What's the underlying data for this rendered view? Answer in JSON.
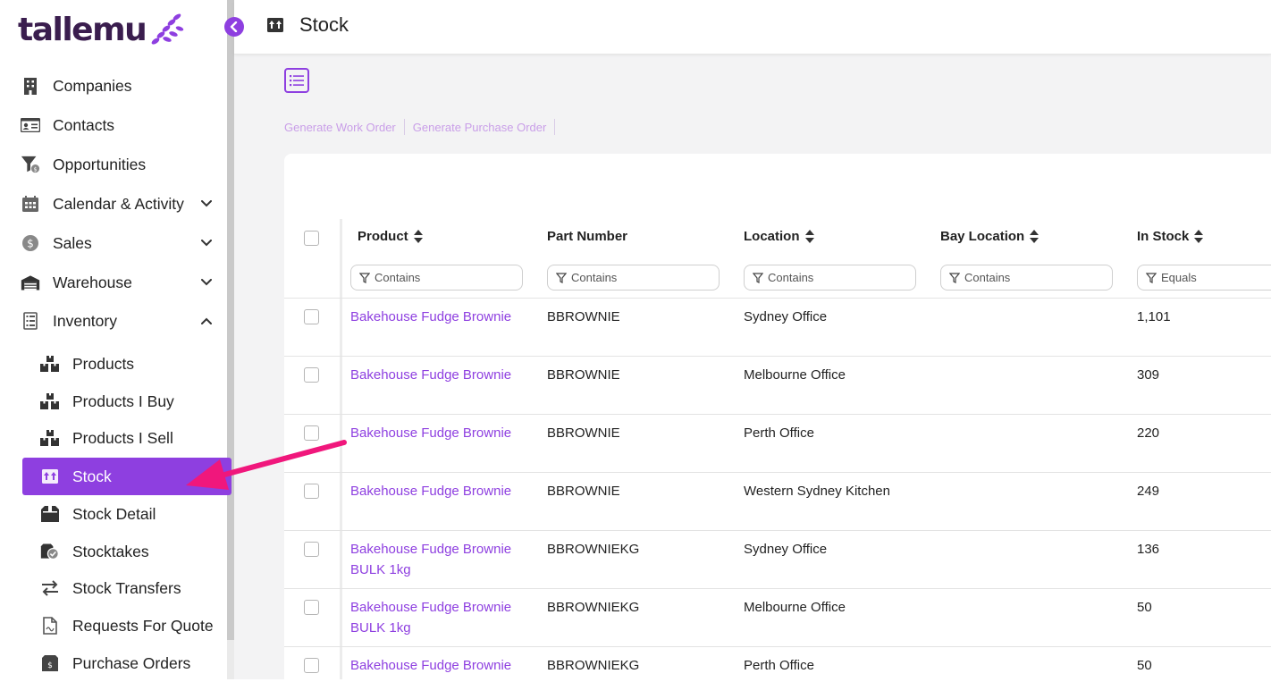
{
  "app": {
    "logo_text": "tallemu",
    "colors": {
      "accent": "#8e3fe0",
      "link": "#8e3fe0",
      "annotation_arrow": "#f0177c",
      "logo": "#3a1d4e"
    }
  },
  "sidebar": {
    "items": [
      {
        "label": "Companies",
        "icon": "building-icon"
      },
      {
        "label": "Contacts",
        "icon": "contact-card-icon"
      },
      {
        "label": "Opportunities",
        "icon": "funnel-dollar-icon"
      },
      {
        "label": "Calendar & Activity",
        "icon": "calendar-icon",
        "expandable": true
      },
      {
        "label": "Sales",
        "icon": "dollar-coin-icon",
        "expandable": true
      },
      {
        "label": "Warehouse",
        "icon": "warehouse-icon",
        "expandable": true
      },
      {
        "label": "Inventory",
        "icon": "inventory-list-icon",
        "expanded": true
      }
    ],
    "inventory_sub_items": [
      {
        "label": "Products",
        "icon": "boxes-icon"
      },
      {
        "label": "Products I Buy",
        "icon": "boxes-icon"
      },
      {
        "label": "Products I Sell",
        "icon": "boxes-icon"
      },
      {
        "label": "Stock",
        "icon": "stock-box-icon",
        "active": true
      },
      {
        "label": "Stock Detail",
        "icon": "open-box-icon"
      },
      {
        "label": "Stocktakes",
        "icon": "stocktake-check-icon"
      },
      {
        "label": "Stock Transfers",
        "icon": "transfer-arrows-icon"
      },
      {
        "label": "Requests For Quote",
        "icon": "document-icon"
      },
      {
        "label": "Purchase Orders",
        "icon": "purchase-order-icon"
      }
    ]
  },
  "header": {
    "title": "Stock"
  },
  "toolbar": {
    "actions": [
      "Generate Work Order",
      "Generate Purchase Order"
    ]
  },
  "grid": {
    "columns": [
      {
        "label": "Product",
        "sortable": true,
        "filter_placeholder": "Contains"
      },
      {
        "label": "Part Number",
        "sortable": false,
        "filter_placeholder": "Contains"
      },
      {
        "label": "Location",
        "sortable": true,
        "filter_placeholder": "Contains"
      },
      {
        "label": "Bay Location",
        "sortable": true,
        "filter_placeholder": "Contains"
      },
      {
        "label": "In Stock",
        "sortable": true,
        "filter_placeholder": "Equals"
      }
    ],
    "rows": [
      {
        "product": "Bakehouse Fudge Brownie",
        "part_number": "BBROWNIE",
        "location": "Sydney Office",
        "bay_location": "",
        "in_stock": "1,101"
      },
      {
        "product": "Bakehouse Fudge Brownie",
        "part_number": "BBROWNIE",
        "location": "Melbourne Office",
        "bay_location": "",
        "in_stock": "309"
      },
      {
        "product": "Bakehouse Fudge Brownie",
        "part_number": "BBROWNIE",
        "location": "Perth Office",
        "bay_location": "",
        "in_stock": "220"
      },
      {
        "product": "Bakehouse Fudge Brownie",
        "part_number": "BBROWNIE",
        "location": "Western Sydney Kitchen",
        "bay_location": "",
        "in_stock": "249"
      },
      {
        "product": "Bakehouse Fudge Brownie BULK 1kg",
        "part_number": "BBROWNIEKG",
        "location": "Sydney Office",
        "bay_location": "",
        "in_stock": "136"
      },
      {
        "product": "Bakehouse Fudge Brownie BULK 1kg",
        "part_number": "BBROWNIEKG",
        "location": "Melbourne Office",
        "bay_location": "",
        "in_stock": "50"
      },
      {
        "product": "Bakehouse Fudge Brownie",
        "part_number": "BBROWNIEKG",
        "location": "Perth Office",
        "bay_location": "",
        "in_stock": "50"
      }
    ]
  }
}
